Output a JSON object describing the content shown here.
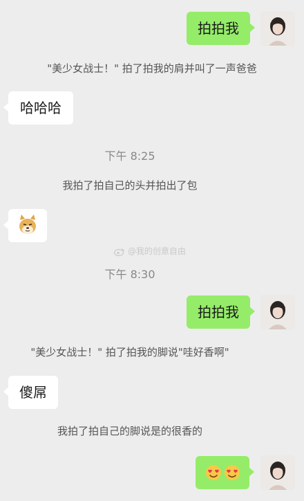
{
  "messages": {
    "m1_text": "拍拍我",
    "m2_system": "\"美少女战士！\" 拍了拍我的肩并叫了一声爸爸",
    "m3_text": "哈哈哈",
    "time1": "下午 8:25",
    "m4_system": "我拍了拍自己的头并拍出了包",
    "time2": "下午 8:30",
    "m6_text": "拍拍我",
    "m7_system": "\"美少女战士！\" 拍了拍我的脚说\"哇好香啊\"",
    "m8_text": "傻屌",
    "m9_system": "我拍了拍自己的脚说是的很香的"
  },
  "watermark": "@我的创意自由",
  "stickers": [
    "doge-emoji",
    "heart-eyes-emoji",
    "heart-eyes-emoji"
  ],
  "colors": {
    "background": "#ededed",
    "bubble_self": "#95ec69",
    "bubble_other": "#ffffff"
  }
}
